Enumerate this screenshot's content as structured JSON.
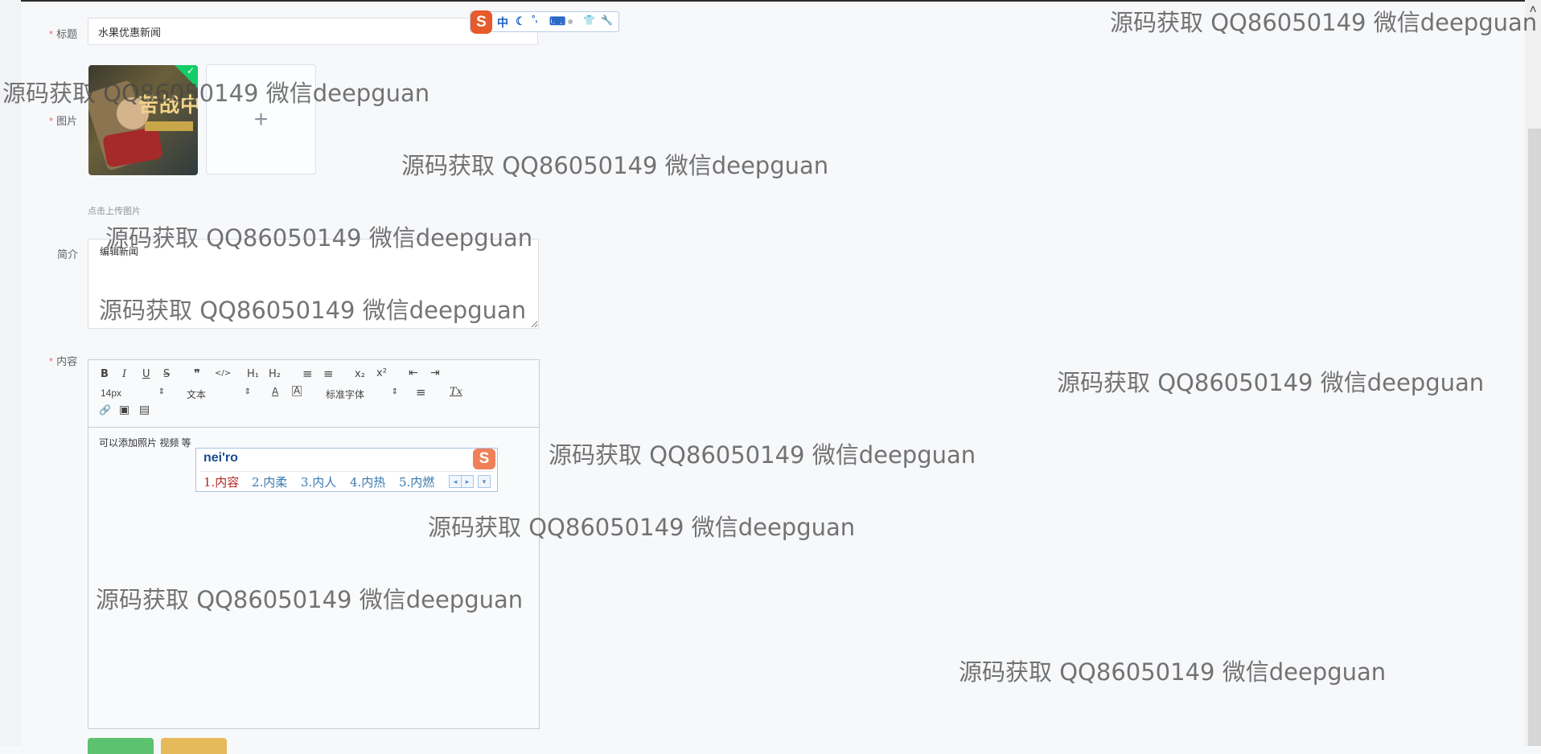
{
  "form": {
    "title_label": "标题",
    "title_value": "水果优惠新闻",
    "image_label": "图片",
    "image_art_text": "苦战中考",
    "upload_plus": "+",
    "upload_tip": "点击上传图片",
    "desc_label": "简介",
    "desc_value": "编辑新闻",
    "content_label": "内容",
    "content_text": "可以添加照片 视频 等"
  },
  "toolbar": {
    "bold": "B",
    "italic": "I",
    "underline": "U",
    "strike": "S",
    "quote": "❞",
    "code": "</>",
    "h1": "H₁",
    "h2": "H₂",
    "ordered_list": "≡",
    "bullet_list": "≡",
    "subscript": "x₂",
    "superscript": "x²",
    "outdent": "⇤",
    "indent": "⇥",
    "size_value": "14px",
    "block_value": "文本",
    "color": "A",
    "background": "A",
    "font_value": "标准字体",
    "align": "≡",
    "clean": "Tx",
    "link": "🔗",
    "image": "▣",
    "video": "▤"
  },
  "ime": {
    "composition": "nei'ro",
    "candidates": [
      "1.内容",
      "2.内柔",
      "3.内人",
      "4.内热",
      "5.内燃"
    ],
    "logo": "S",
    "prev": "◂",
    "next": "▸",
    "more": "▾"
  },
  "ime_bar": {
    "logo": "S",
    "mode": "中",
    "moon": "☾",
    "punct": "°,",
    "keyboard": "⌨",
    "user": "●",
    "skin": "👕",
    "tools": "🔧"
  },
  "watermark": "源码获取 QQ86050149 微信deepguan",
  "scroll_up": "˄"
}
